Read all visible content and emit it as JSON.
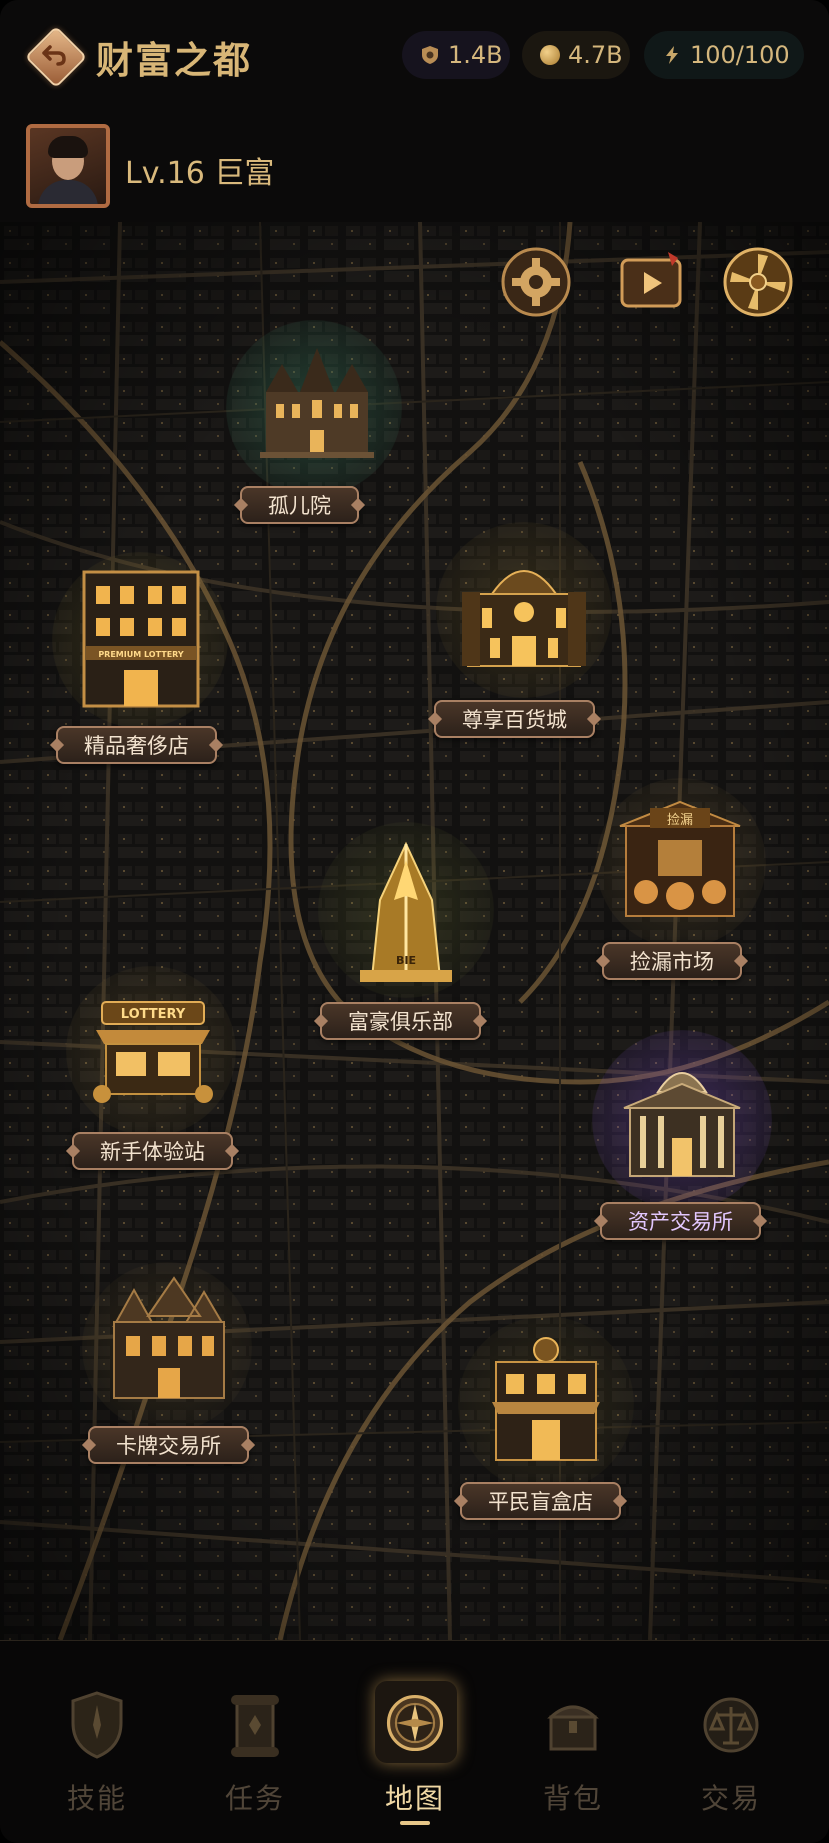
{
  "header": {
    "title": "财富之都",
    "back_icon": "back-arrow-icon",
    "resources": [
      {
        "icon": "shield-icon",
        "value": "1.4B"
      },
      {
        "icon": "coin-icon",
        "value": "4.7B"
      },
      {
        "icon": "lightning-icon",
        "value": "100/100"
      }
    ]
  },
  "profile": {
    "level_text": "Lv.16 巨富"
  },
  "map": {
    "buttons": [
      {
        "icon": "gear-icon"
      },
      {
        "icon": "video-icon"
      },
      {
        "icon": "wheel-icon"
      }
    ],
    "buildings": [
      {
        "name": "孤儿院"
      },
      {
        "name": "精品奢侈店",
        "sign": "PREMIUM LOTTERY"
      },
      {
        "name": "尊享百货城"
      },
      {
        "name": "捡漏市场",
        "sign": "捡漏"
      },
      {
        "name": "富豪俱乐部",
        "sign": "BIE"
      },
      {
        "name": "新手体验站",
        "sign": "LOTTERY"
      },
      {
        "name": "资产交易所"
      },
      {
        "name": "卡牌交易所"
      },
      {
        "name": "平民盲盒店"
      }
    ]
  },
  "nav": {
    "items": [
      {
        "label": "技能",
        "icon": "shield-skill-icon"
      },
      {
        "label": "任务",
        "icon": "scroll-icon"
      },
      {
        "label": "地图",
        "icon": "compass-icon"
      },
      {
        "label": "背包",
        "icon": "chest-icon"
      },
      {
        "label": "交易",
        "icon": "scales-icon"
      }
    ],
    "active": "地图"
  },
  "colors": {
    "accent_gold": "#d8b677",
    "label_bg": "#3a2b21",
    "purple_glow": "#7a4fc0",
    "green_glow": "#3f8a6a"
  }
}
